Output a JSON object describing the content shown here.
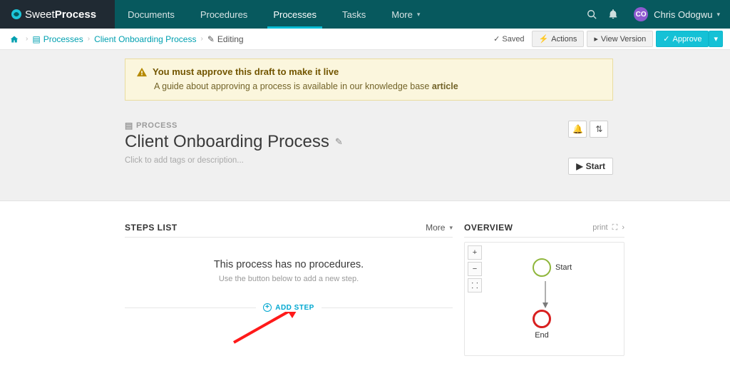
{
  "brand": {
    "thin": "Sweet",
    "bold": "Process"
  },
  "nav": {
    "items": [
      "Documents",
      "Procedures",
      "Processes",
      "Tasks",
      "More"
    ],
    "active_index": 2
  },
  "user": {
    "initials": "CO",
    "name": "Chris Odogwu"
  },
  "breadcrumb": {
    "processes": "Processes",
    "current": "Client Onboarding Process",
    "state": "Editing"
  },
  "toolbar": {
    "saved": "Saved",
    "actions": "Actions",
    "view_version": "View Version",
    "approve": "Approve"
  },
  "alert": {
    "title": "You must approve this draft to make it live",
    "subtitle_a": "A guide about approving a process is available in our knowledge base ",
    "subtitle_link": "article"
  },
  "process": {
    "kicker": "PROCESS",
    "title": "Client Onboarding Process",
    "desc_placeholder": "Click to add tags or description...",
    "start": "Start"
  },
  "steps": {
    "title": "STEPS LIST",
    "more": "More",
    "empty_title": "This process has no procedures.",
    "empty_sub": "Use the button below to add a new step.",
    "add": "ADD STEP"
  },
  "overview": {
    "title": "OVERVIEW",
    "print": "print",
    "nodes": {
      "start": "Start",
      "end": "End"
    }
  }
}
